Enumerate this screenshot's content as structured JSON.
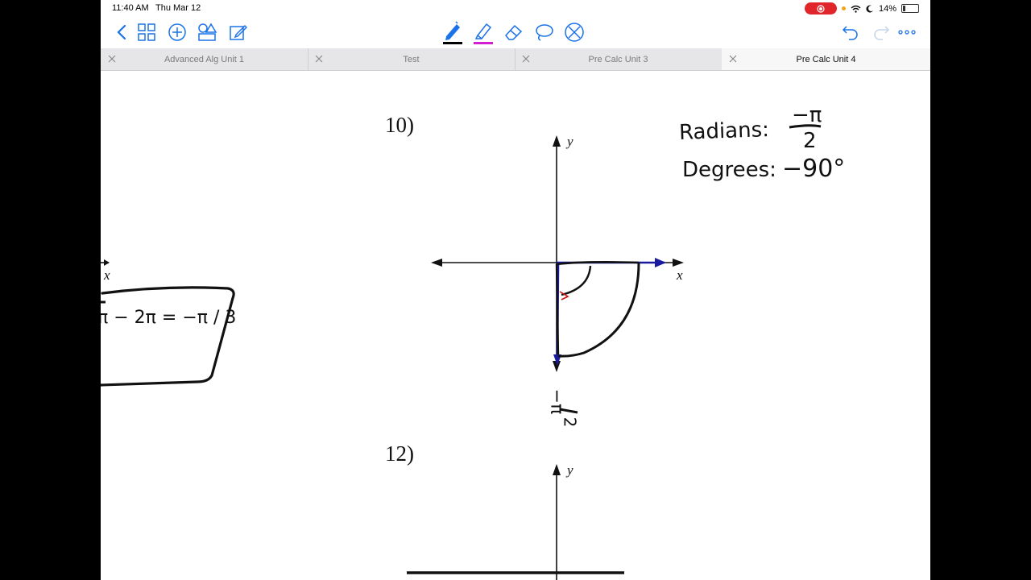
{
  "status": {
    "time": "11:40 AM",
    "date": "Thu Mar 12",
    "battery": "14%"
  },
  "tabs": [
    {
      "label": "Advanced Alg Unit 1",
      "active": false
    },
    {
      "label": "Test",
      "active": false
    },
    {
      "label": "Pre Calc Unit 3",
      "active": false
    },
    {
      "label": "Pre Calc Unit 4",
      "active": true
    }
  ],
  "colors": {
    "accent": "#1a73e8",
    "pen_underline": "#000000",
    "highlighter_underline": "#d21fd2",
    "record": "#e0262b",
    "ink_blue": "#1a1aa0",
    "ink_red": "#cc1111"
  },
  "icons": {
    "back": "chevron-left-icon",
    "thumbnails": "grid-icon",
    "add": "plus-circle-icon",
    "shapes": "shapes-icon",
    "edit": "pencil-square-icon",
    "pen": "pen-icon",
    "highlighter": "highlighter-icon",
    "eraser": "eraser-icon",
    "lasso": "lasso-icon",
    "no_touch": "no-touch-icon",
    "undo": "undo-icon",
    "redo": "redo-icon",
    "more": "ellipsis-icon"
  },
  "worksheet": {
    "q10": {
      "number": "10)",
      "axis_x": "x",
      "axis_y": "y",
      "radians_label": "Radians:",
      "radians_num": "−π",
      "radians_den": "2",
      "degrees_label": "Degrees:",
      "degrees_value": "−90°",
      "terminal_num": "−π",
      "terminal_den": "2"
    },
    "q12": {
      "number": "12)",
      "axis_y": "y"
    },
    "left_partial": {
      "axis_x": "x",
      "box_text": "π − 2π = −π / 3"
    }
  }
}
